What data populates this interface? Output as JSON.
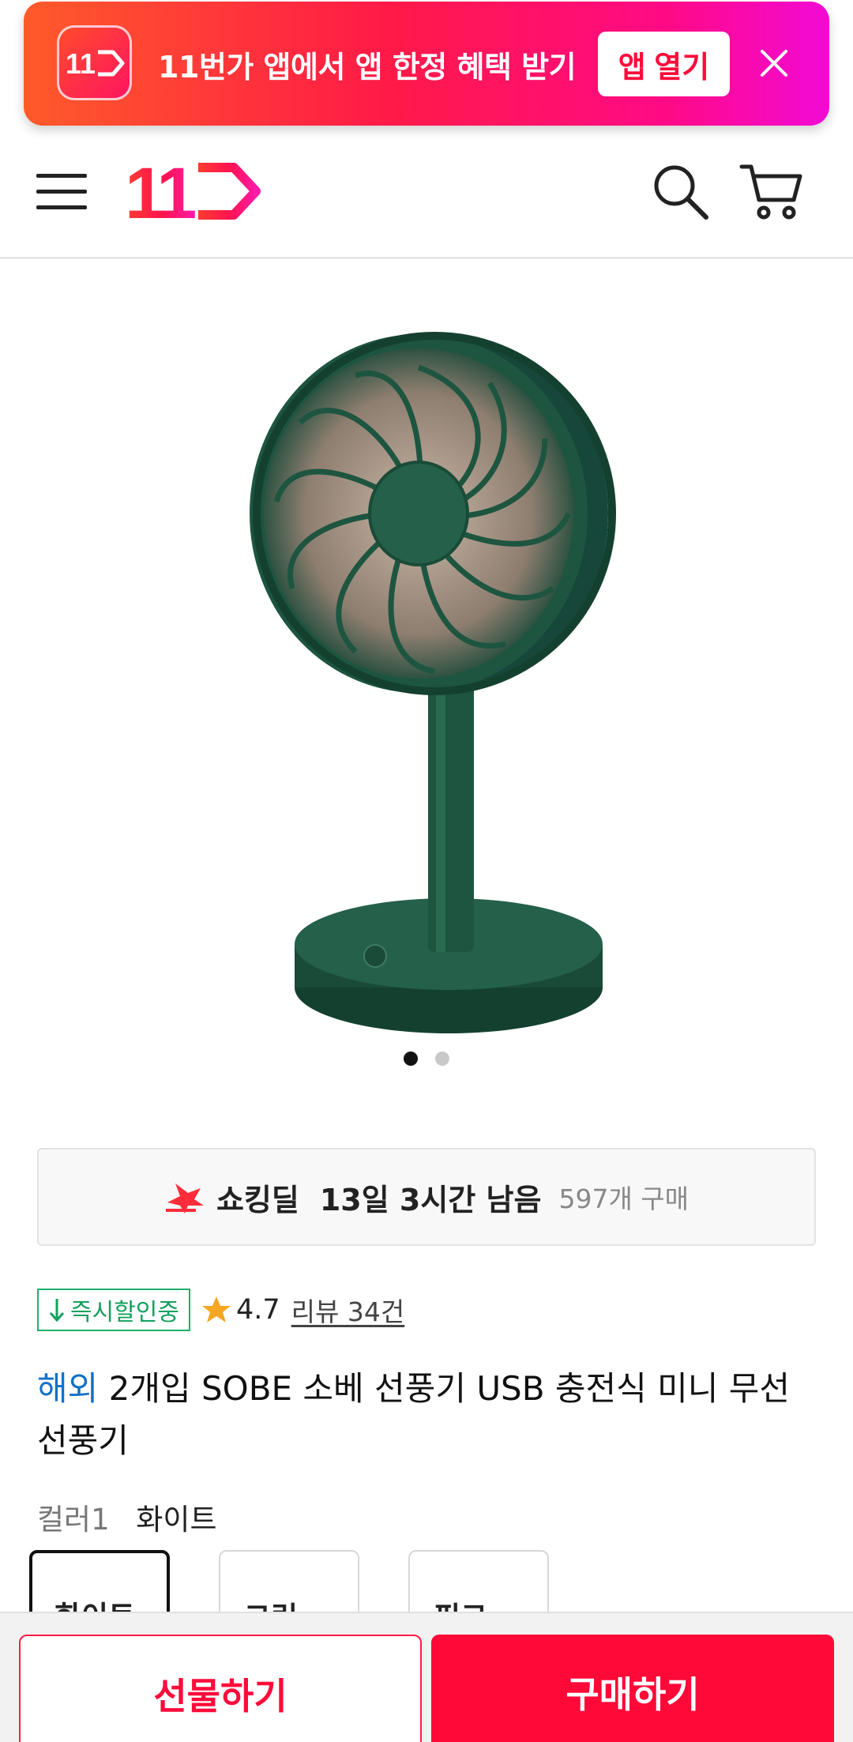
{
  "app_banner": {
    "logo_text": "11",
    "message": "11번가 앱에서 앱 한정 혜택 받기",
    "open_label": "앱 열기",
    "gradient_colors": [
      "#ff5a2a",
      "#ff1a47",
      "#ff0a86",
      "#f20ad6"
    ]
  },
  "header": {
    "logo_text": "11",
    "icons": [
      "menu-icon",
      "search-icon",
      "cart-icon"
    ]
  },
  "gallery": {
    "image_subject": "green desk fan",
    "current_slide": 1,
    "total_slides": 2
  },
  "deal": {
    "title": "쇼킹딜",
    "time_left": "13일 3시간 남음",
    "sold": "597개 구매"
  },
  "badges": {
    "certification": "즉시할인중",
    "rating": "4.7",
    "reviews": "리뷰 34건"
  },
  "product": {
    "origin_tag": "해외",
    "title": "2개입 SOBE 소베 선풍기 USB 충전식 미니 무선선풍기"
  },
  "option": {
    "label": "컬러1",
    "selected_value": "화이트",
    "choices": [
      "화이트",
      "그린",
      "핑크"
    ]
  },
  "bottom_bar": {
    "gift_label": "선물하기",
    "buy_label": "구매하기"
  },
  "colors": {
    "brand": "#ff0938",
    "certified_green": "#14a05d",
    "overseas_blue": "#1170c8",
    "star": "#f5a623"
  }
}
